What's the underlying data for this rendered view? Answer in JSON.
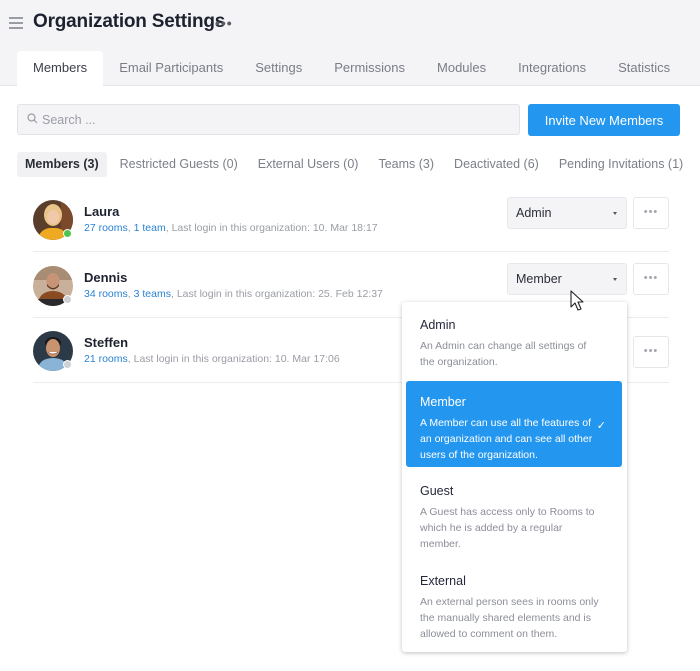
{
  "header": {
    "menu_icon": "hamburger-icon",
    "title": "Organization Settings",
    "more_label": "•••"
  },
  "tabs": [
    {
      "label": "Members",
      "active": true
    },
    {
      "label": "Email Participants",
      "active": false
    },
    {
      "label": "Settings",
      "active": false
    },
    {
      "label": "Permissions",
      "active": false
    },
    {
      "label": "Modules",
      "active": false
    },
    {
      "label": "Integrations",
      "active": false
    },
    {
      "label": "Statistics",
      "active": false
    }
  ],
  "search": {
    "placeholder": "Search ...",
    "value": ""
  },
  "invite_button": "Invite New Members",
  "subtabs": [
    {
      "label": "Members (3)",
      "active": true
    },
    {
      "label": "Restricted Guests (0)",
      "active": false
    },
    {
      "label": "External Users (0)",
      "active": false
    },
    {
      "label": "Teams (3)",
      "active": false
    },
    {
      "label": "Deactivated (6)",
      "active": false
    },
    {
      "label": "Pending Invitations (1)",
      "active": false
    }
  ],
  "members": [
    {
      "name": "Laura",
      "rooms": "27 rooms",
      "teams": "1 team",
      "last_login": "Last login in this organization: 10. Mar 18:17",
      "role": "Admin",
      "online": true
    },
    {
      "name": "Dennis",
      "rooms": "34 rooms",
      "teams": "3 teams",
      "last_login": "Last login in this organization: 25. Feb 12:37",
      "role": "Member",
      "online": false
    },
    {
      "name": "Steffen",
      "rooms": "21 rooms",
      "teams": "",
      "last_login": "Last login in this organization: 10. Mar 17:06",
      "role": "",
      "online": false
    }
  ],
  "row_more_label": "•••",
  "role_dropdown": {
    "options": [
      {
        "title": "Admin",
        "description": "An Admin can change all settings of the organization.",
        "selected": false
      },
      {
        "title": "Member",
        "description": "A Member can use all the features of an organization and can see all other users of the organization.",
        "selected": true
      },
      {
        "title": "Guest",
        "description": "A Guest has access only to Rooms to which he is added by a regular member.",
        "selected": false
      },
      {
        "title": "External",
        "description": "An external person sees in rooms only the manually shared elements and is allowed to comment on them.",
        "selected": false
      }
    ],
    "check_mark": "✓"
  },
  "colors": {
    "accent": "#2396ef",
    "link": "#2a83d2",
    "online": "#4cc450",
    "offline": "#cfd0d4"
  }
}
